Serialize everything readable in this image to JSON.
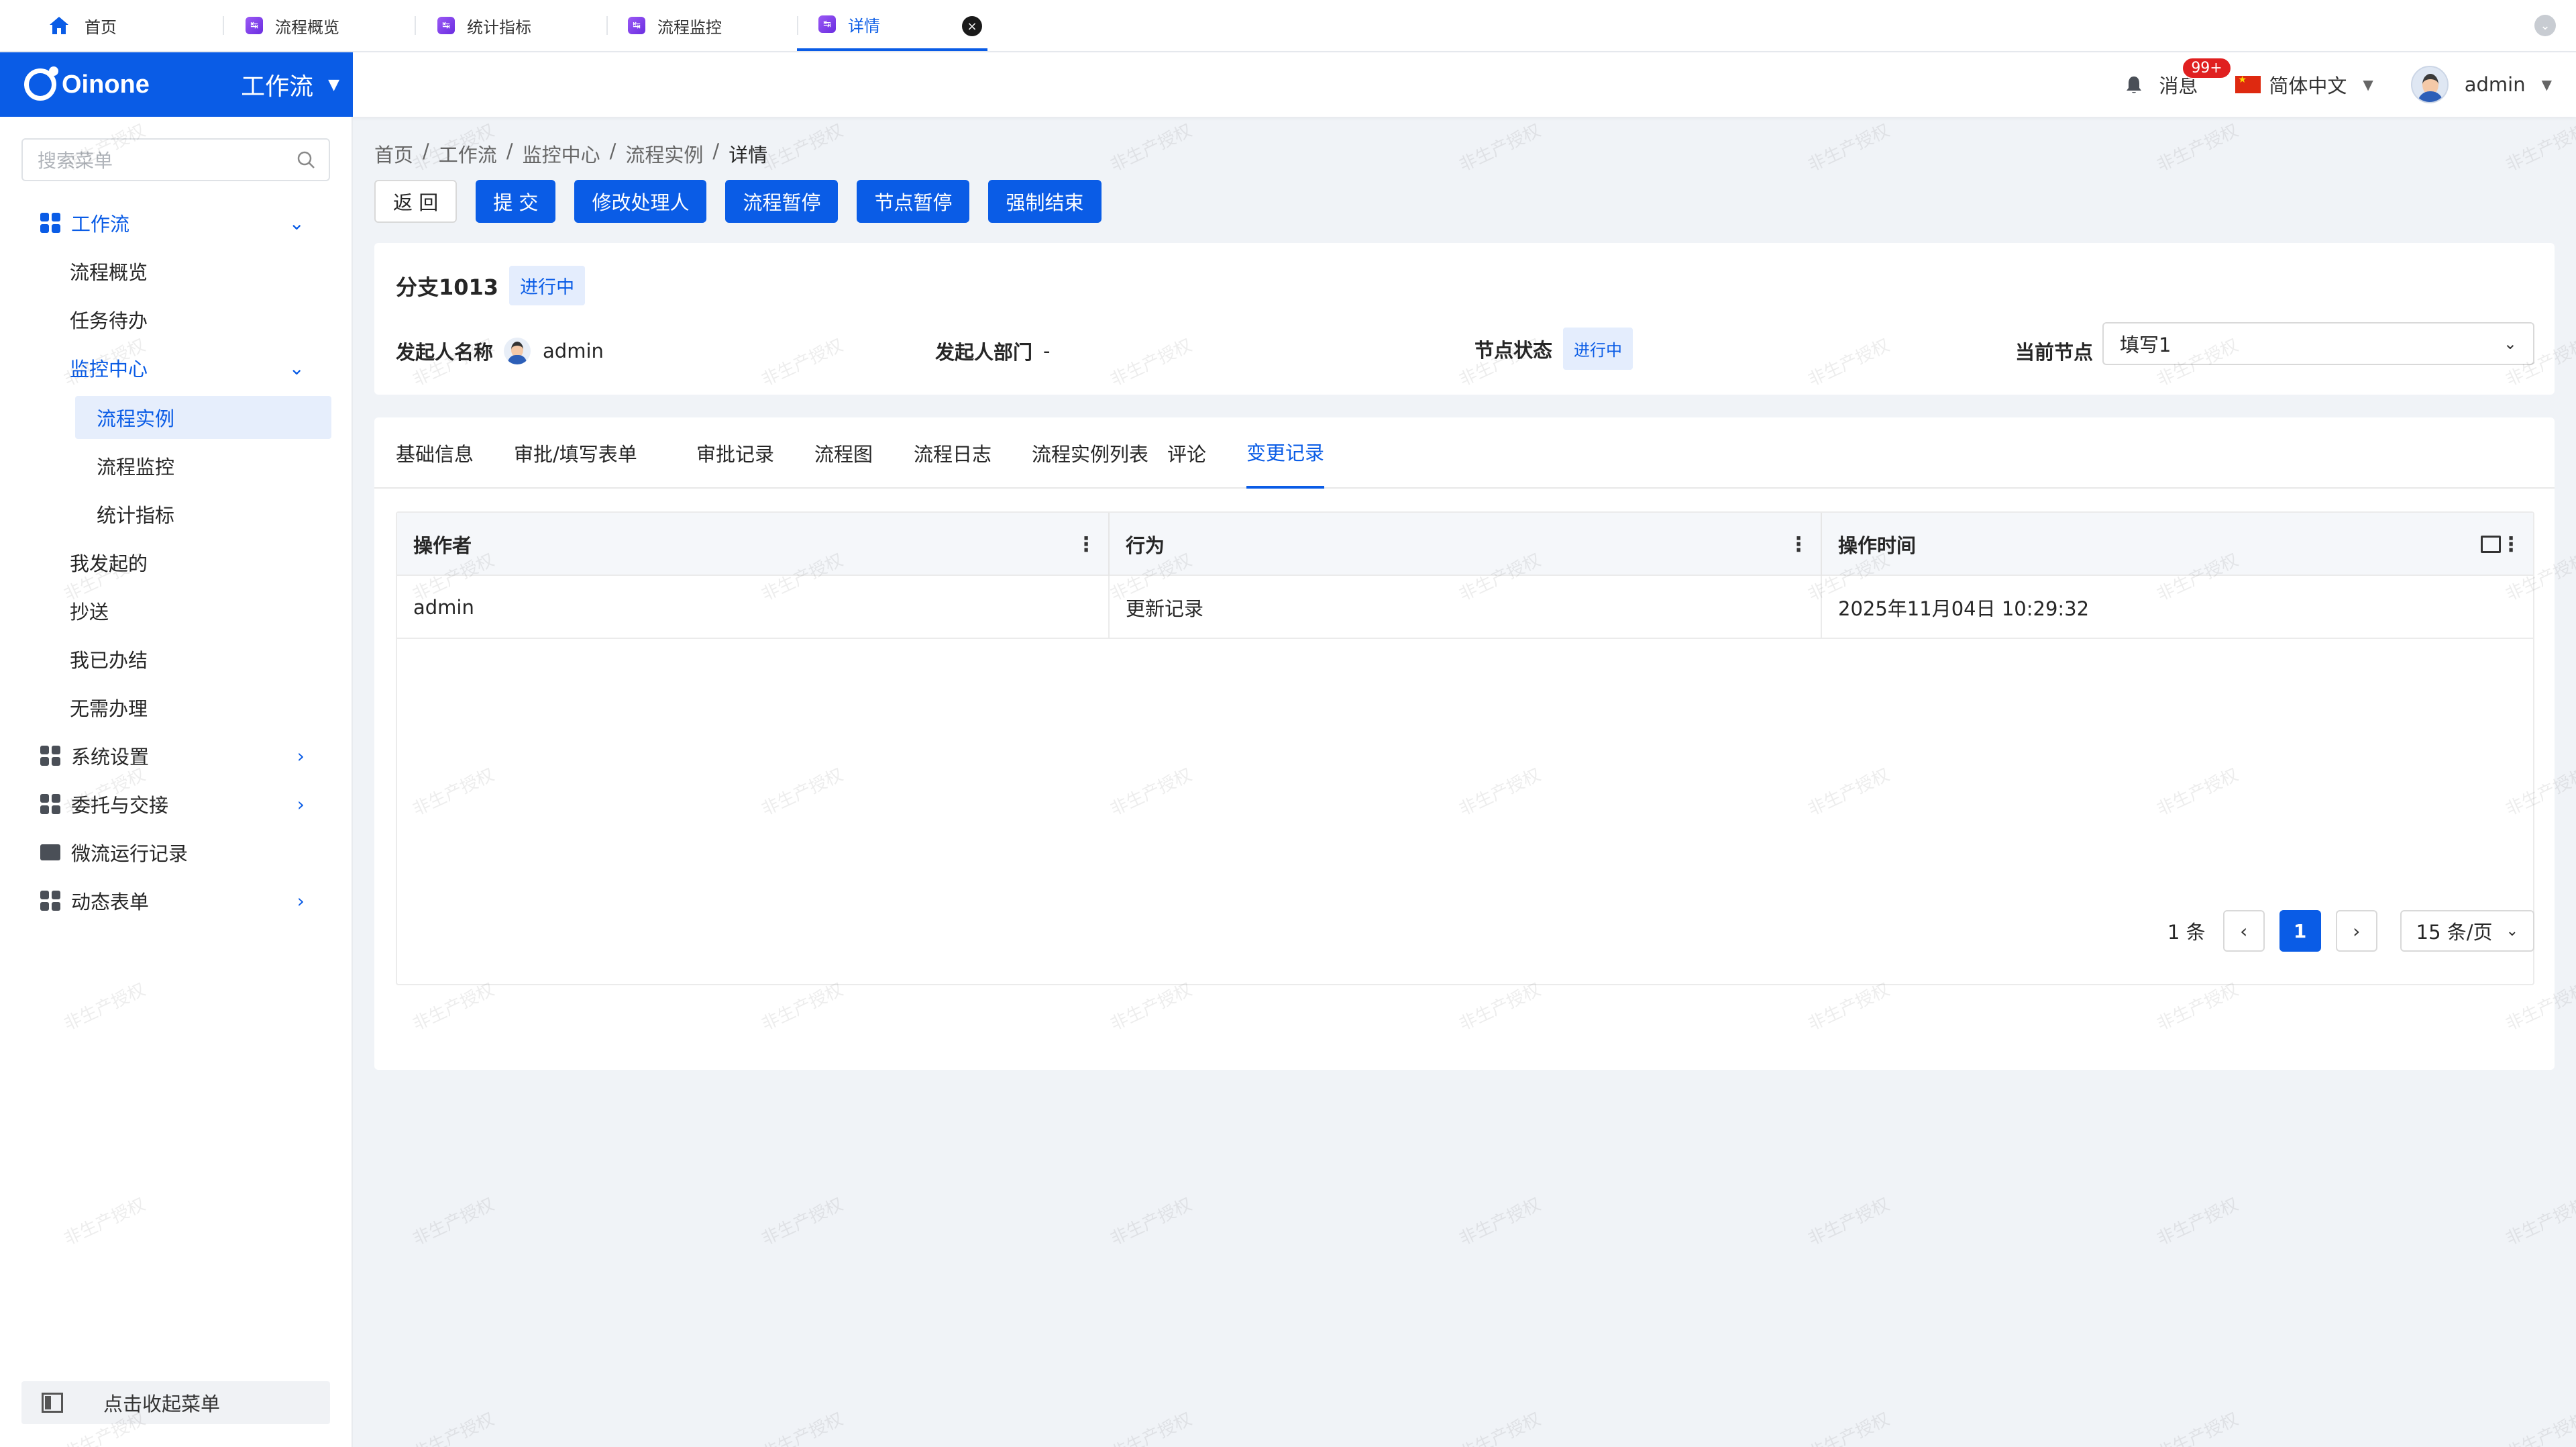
{
  "window_tabs": [
    {
      "label": "首页",
      "icon": "home-icon"
    },
    {
      "label": "流程概览",
      "icon": "app-icon"
    },
    {
      "label": "统计指标",
      "icon": "app-icon"
    },
    {
      "label": "流程监控",
      "icon": "app-icon"
    },
    {
      "label": "详情",
      "icon": "app-icon",
      "active": true
    }
  ],
  "brand": {
    "logo_text": "Oinone",
    "app_name": "工作流"
  },
  "header": {
    "messages_label": "消息",
    "messages_badge": "99+",
    "language": "简体中文",
    "username": "admin"
  },
  "sidebar": {
    "search_placeholder": "搜索菜单",
    "items": [
      {
        "label": "工作流",
        "level": 0,
        "expanded": true
      },
      {
        "label": "流程概览",
        "level": 1
      },
      {
        "label": "任务待办",
        "level": 1
      },
      {
        "label": "监控中心",
        "level": 1,
        "expanded": true
      },
      {
        "label": "流程实例",
        "level": 2,
        "selected": true
      },
      {
        "label": "流程监控",
        "level": 2
      },
      {
        "label": "统计指标",
        "level": 2
      },
      {
        "label": "我发起的",
        "level": 1
      },
      {
        "label": "抄送",
        "level": 1
      },
      {
        "label": "我已办结",
        "level": 1
      },
      {
        "label": "无需办理",
        "level": 1
      },
      {
        "label": "系统设置",
        "level": 0
      },
      {
        "label": "委托与交接",
        "level": 0
      },
      {
        "label": "微流运行记录",
        "level": 0
      },
      {
        "label": "动态表单",
        "level": 0
      }
    ],
    "collapse_label": "点击收起菜单"
  },
  "breadcrumb": [
    "首页",
    "工作流",
    "监控中心",
    "流程实例",
    "详情"
  ],
  "breadcrumb_sep": "/",
  "actions": {
    "back": "返 回",
    "submit": "提 交",
    "change_handler": "修改处理人",
    "pause_flow": "流程暂停",
    "pause_node": "节点暂停",
    "force_end": "强制结束"
  },
  "process": {
    "title": "分支1013",
    "status_tag": "进行中",
    "initiator_label": "发起人名称",
    "initiator_value": "admin",
    "dept_label": "发起人部门",
    "dept_value": "-",
    "node_status_label": "节点状态",
    "node_status_value": "进行中",
    "current_node_label": "当前节点",
    "current_node_value": "填写1"
  },
  "detail_tabs": [
    "基础信息",
    "审批/填写表单",
    "审批记录",
    "流程图",
    "流程日志",
    "流程实例列表",
    "评论",
    "变更记录"
  ],
  "active_detail_tab": "变更记录",
  "table": {
    "columns": [
      "操作者",
      "行为",
      "操作时间"
    ],
    "rows": [
      [
        "admin",
        "更新记录",
        "2025年11月04日 10:29:32"
      ]
    ]
  },
  "pagination": {
    "total": "1 条",
    "current_page": "1",
    "page_size": "15 条/页"
  },
  "watermark": "非生产授权",
  "colors": {
    "primary": "#0a5ce6",
    "badge": "#e02020",
    "background": "#f0f3f7"
  }
}
